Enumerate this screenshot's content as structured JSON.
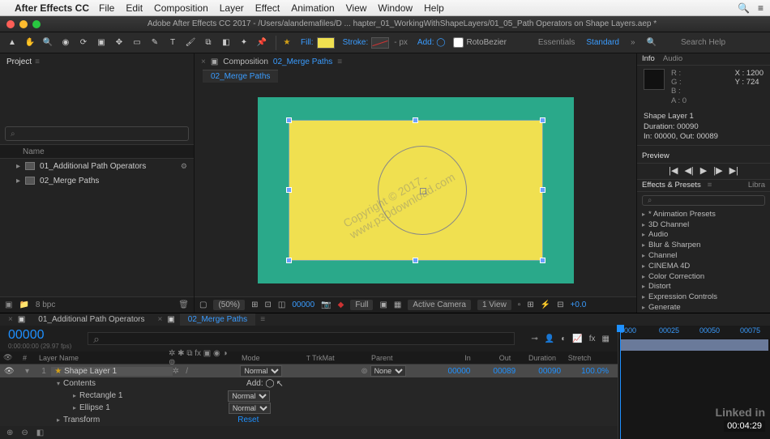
{
  "mac_menu": {
    "app": "After Effects CC",
    "items": [
      "File",
      "Edit",
      "Composition",
      "Layer",
      "Effect",
      "Animation",
      "View",
      "Window",
      "Help"
    ]
  },
  "window_title": "Adobe After Effects CC 2017 - /Users/alandemafiles/D ... hapter_01_WorkingWithShapeLayers/01_05_Path Operators on Shape Layers.aep *",
  "toolbar": {
    "fill_label": "Fill:",
    "stroke_label": "Stroke:",
    "stroke_px": "- px",
    "add_label": "Add: ◯",
    "rotobezier": "RotoBezier",
    "workspaces": {
      "w1": "Essentials",
      "w2": "Standard"
    },
    "search_placeholder": "Search Help"
  },
  "project": {
    "tab": "Project",
    "name_col": "Name",
    "items": [
      {
        "label": "01_Additional Path Operators",
        "badge": "⚙"
      },
      {
        "label": "02_Merge Paths",
        "badge": ""
      }
    ],
    "search_placeholder": "⌕",
    "footer_bpc": "8 bpc"
  },
  "composition": {
    "crumb_label": "Composition",
    "crumb_name": "02_Merge Paths",
    "subtab": "02_Merge Paths",
    "footer": {
      "zoom": "(50%)",
      "time": "00000",
      "res": "Full",
      "camera": "Active Camera",
      "view": "1 View",
      "exposure": "+0.0"
    }
  },
  "info": {
    "tab_info": "Info",
    "tab_audio": "Audio",
    "R": "R :",
    "G": "G :",
    "B": "B :",
    "A": "A : 0",
    "X": "X : 1200",
    "Y": "Y : 724",
    "shape_name": "Shape Layer 1",
    "duration": "Duration: 00090",
    "inout": "In: 00000, Out: 00089"
  },
  "preview": {
    "tab": "Preview"
  },
  "effects_presets": {
    "tab": "Effects & Presets",
    "tab2": "Libra",
    "search_placeholder": "⌕",
    "items": [
      "* Animation Presets",
      "3D Channel",
      "Audio",
      "Blur & Sharpen",
      "Channel",
      "CINEMA 4D",
      "Color Correction",
      "Distort",
      "Expression Controls",
      "Generate"
    ]
  },
  "timeline": {
    "tab1": "01_Additional Path Operators",
    "tab2": "02_Merge Paths",
    "timecode": "00000",
    "fps": "0:00:00:00 (29.97 fps)",
    "ruler": [
      "0000",
      "00025",
      "00050",
      "00075"
    ],
    "cols": {
      "layer_name": "Layer Name",
      "mode": "Mode",
      "trkmat": "TrkMat",
      "parent": "Parent",
      "in": "In",
      "out": "Out",
      "dur": "Duration",
      "str": "Stretch"
    },
    "layer": {
      "num": "1",
      "name": "Shape Layer 1",
      "mode": "Normal",
      "parent": "None",
      "in": "00000",
      "out": "00089",
      "dur": "00090",
      "stretch": "100.0%"
    },
    "contents": "Contents",
    "add": "Add: ◯",
    "rect": "Rectangle 1",
    "ellipse": "Ellipse 1",
    "transform": "Transform",
    "rect_mode": "Normal",
    "ellipse_mode": "Normal",
    "reset": "Reset"
  },
  "linkedin": "Linked in",
  "video_time": "00:04:29"
}
